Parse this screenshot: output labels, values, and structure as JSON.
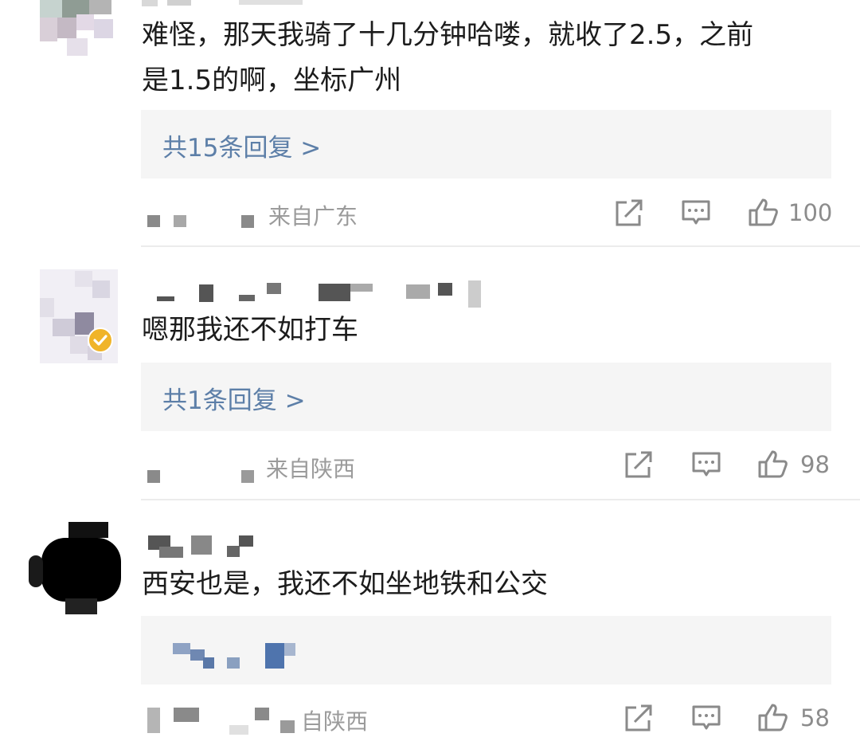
{
  "comments": [
    {
      "text_lines": [
        "难怪，那天我骑了十几分钟哈喽，就收了2.5，之前",
        "是1.5的啊，坐标广州"
      ],
      "reply_link": "共15条回复 >",
      "location": "来自广东",
      "likes": "100"
    },
    {
      "text_lines": [
        "嗯那我还不如打车"
      ],
      "reply_link": "共1条回复 >",
      "location": "来自陕西",
      "likes": "98"
    },
    {
      "text_lines": [
        "西安也是，我还不如坐地铁和公交"
      ],
      "location": "自陕西",
      "likes": "58"
    }
  ],
  "icons": [
    "share-icon",
    "comment-icon",
    "like-icon",
    "verified-badge-icon"
  ],
  "colors": {
    "reply_link": "#5d7fa8",
    "meta_gray": "#9b9b9b",
    "reply_bg": "#f5f5f5",
    "verified": "#f0b429"
  }
}
